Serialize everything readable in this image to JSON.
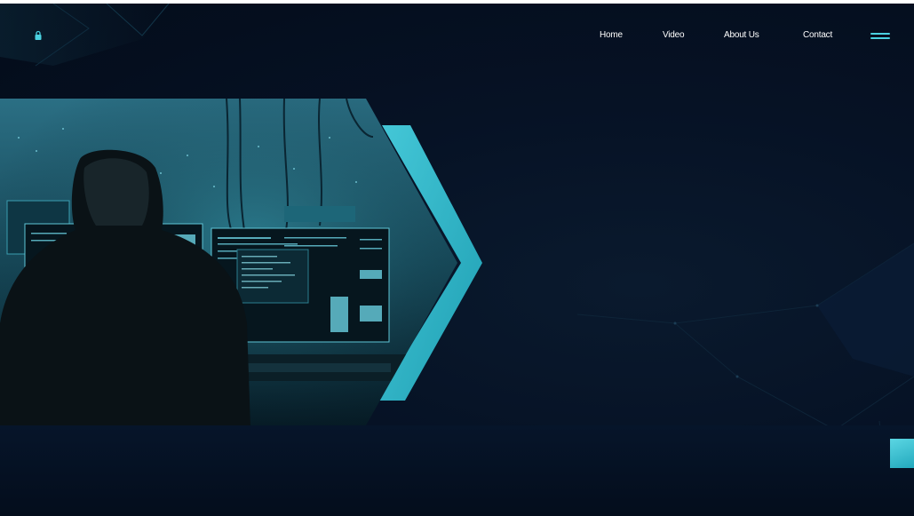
{
  "header": {
    "logo_icon": "lock-icon",
    "nav": [
      {
        "label": "Home"
      },
      {
        "label": "Video"
      },
      {
        "label": "About Us"
      },
      {
        "label": "Contact"
      }
    ],
    "menu_icon": "hamburger-menu-icon"
  },
  "hero": {
    "image_subject": "hooded-figure-at-computer-monitors",
    "accent_shape": "chevron-arrow-icon"
  },
  "scroll_top": {
    "icon": "scroll-top-icon"
  },
  "colors": {
    "background": "#061225",
    "accent": "#2fb6c8",
    "accent_light": "#5bd6e3",
    "nav_text": "#ffffff"
  }
}
